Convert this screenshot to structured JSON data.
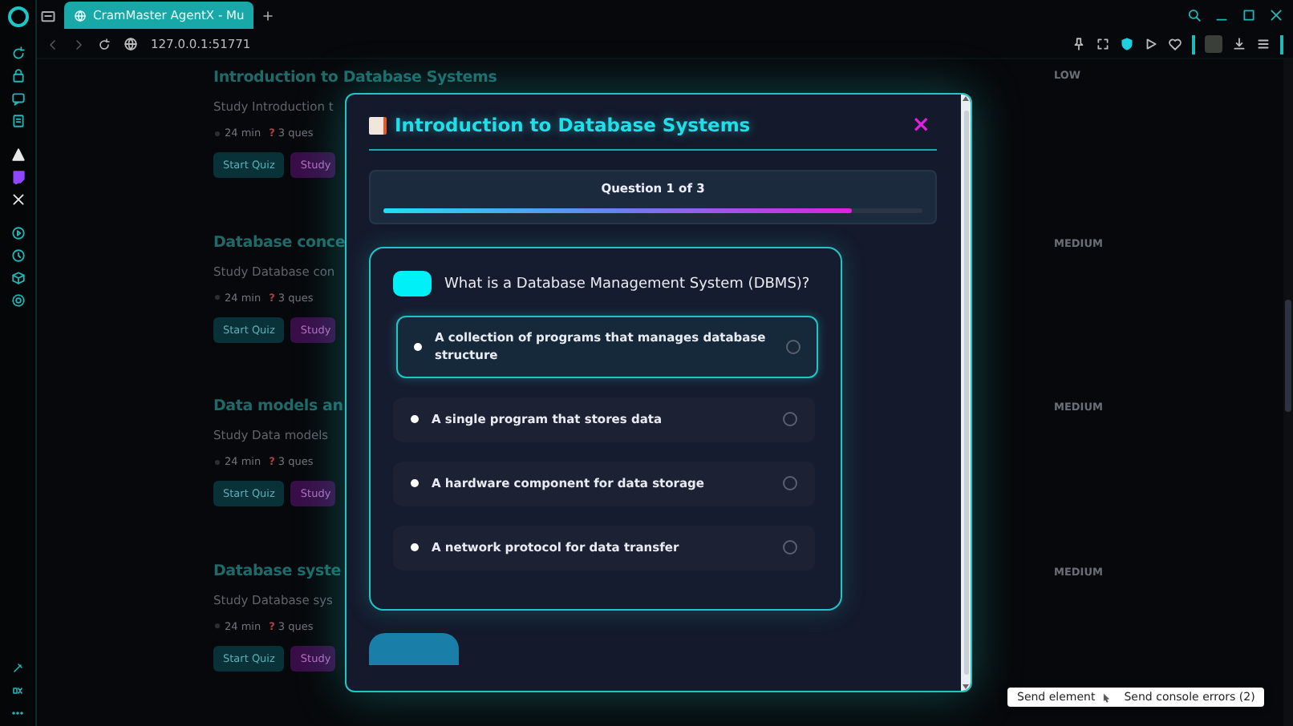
{
  "browser": {
    "tab_title": "CramMaster AgentX - Mu",
    "url": "127.0.0.1:51771"
  },
  "background_cards": [
    {
      "title": "Introduction to Database Systems",
      "description": "Study Introduction t",
      "duration": "24 min",
      "question_icon": "?",
      "questions": "3 ques",
      "start_label": "Start Quiz",
      "study_label": "Study",
      "difficulty": "LOW"
    },
    {
      "title": "Database conce",
      "description": "Study Database con",
      "duration": "24 min",
      "question_icon": "?",
      "questions": "3 ques",
      "start_label": "Start Quiz",
      "study_label": "Study",
      "difficulty": "MEDIUM"
    },
    {
      "title": "Data models an",
      "description": "Study Data models",
      "duration": "24 min",
      "question_icon": "?",
      "questions": "3 ques",
      "start_label": "Start Quiz",
      "study_label": "Study",
      "difficulty": "MEDIUM"
    },
    {
      "title": "Database syste",
      "description": "Study Database sys",
      "duration": "24 min",
      "question_icon": "?",
      "questions": "3 ques",
      "start_label": "Start Quiz",
      "study_label": "Study",
      "difficulty": "MEDIUM"
    }
  ],
  "modal": {
    "title": "Introduction to Database Systems",
    "close": "×",
    "progress_label": "Question 1 of 3",
    "progress": {
      "level": 0.87
    },
    "question": "What is a Database Management System (DBMS)?",
    "options": [
      {
        "text": "A collection of programs that manages database structure",
        "selected": true
      },
      {
        "text": "A single program that stores data",
        "selected": false
      },
      {
        "text": "A hardware component for data storage",
        "selected": false
      },
      {
        "text": "A network protocol for data transfer",
        "selected": false
      }
    ]
  },
  "devtools": {
    "send_element": "Send element",
    "send_console_errors": "Send console errors (2)"
  }
}
